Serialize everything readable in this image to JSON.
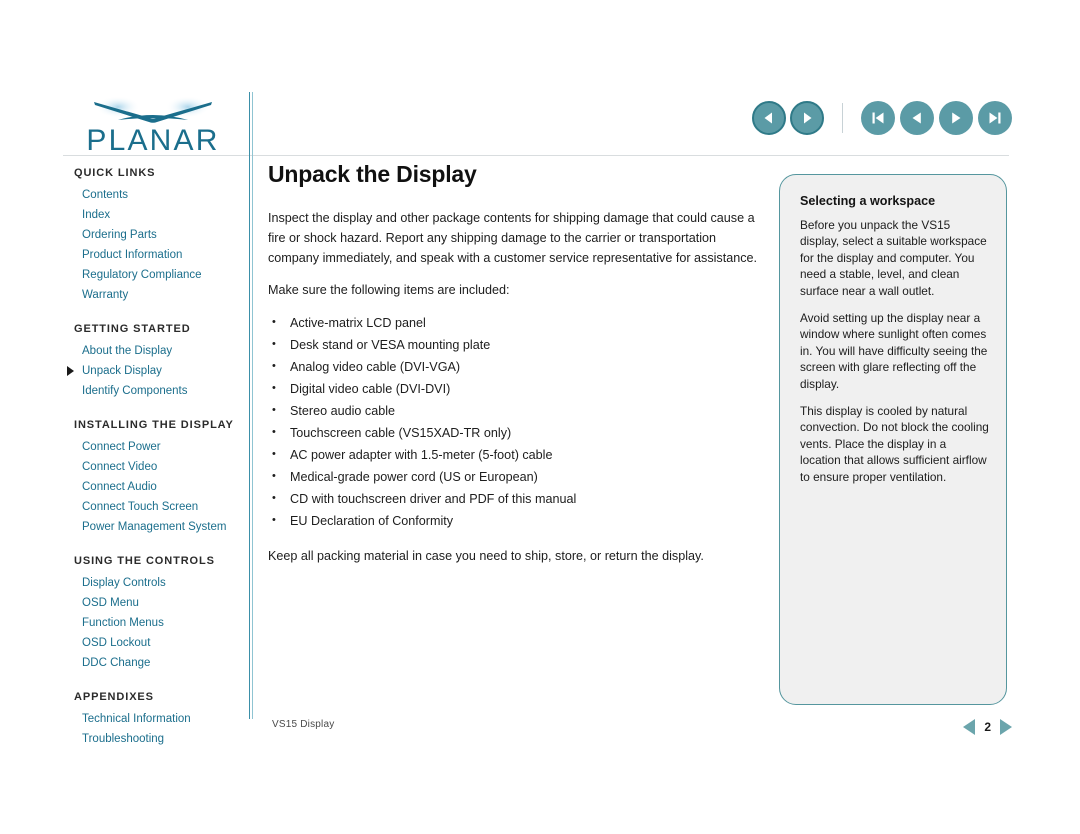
{
  "brand": {
    "name": "PLANAR",
    "logo_color": "#1b6e8c",
    "swoosh_glow": "#bcdcee"
  },
  "topnav": {
    "group1": [
      {
        "icon": "arrow-left-icon",
        "name": "back-button"
      },
      {
        "icon": "arrow-right-icon",
        "name": "forward-button"
      }
    ],
    "group2": [
      {
        "icon": "first-page-icon",
        "name": "first-page-button"
      },
      {
        "icon": "previous-page-icon",
        "name": "previous-page-button"
      },
      {
        "icon": "next-page-icon",
        "name": "next-page-button"
      },
      {
        "icon": "last-page-icon",
        "name": "last-page-button"
      }
    ],
    "button_color": "#5b9ba6",
    "ring_color": "#2f7a88"
  },
  "sidebar": {
    "sections": [
      {
        "heading": "QUICK LINKS",
        "links": [
          {
            "label": "Contents",
            "current": false
          },
          {
            "label": "Index",
            "current": false
          },
          {
            "label": "Ordering Parts",
            "current": false
          },
          {
            "label": "Product Information",
            "current": false
          },
          {
            "label": "Regulatory Compliance",
            "current": false
          },
          {
            "label": "Warranty",
            "current": false
          }
        ]
      },
      {
        "heading": "GETTING STARTED",
        "links": [
          {
            "label": "About the Display",
            "current": false
          },
          {
            "label": "Unpack Display",
            "current": true
          },
          {
            "label": "Identify Components",
            "current": false
          }
        ]
      },
      {
        "heading": "INSTALLING THE DISPLAY",
        "links": [
          {
            "label": "Connect Power",
            "current": false
          },
          {
            "label": "Connect Video",
            "current": false
          },
          {
            "label": "Connect Audio",
            "current": false
          },
          {
            "label": "Connect Touch Screen",
            "current": false
          },
          {
            "label": "Power Management System",
            "current": false
          }
        ]
      },
      {
        "heading": "USING THE CONTROLS",
        "links": [
          {
            "label": "Display Controls",
            "current": false
          },
          {
            "label": "OSD Menu",
            "current": false
          },
          {
            "label": "Function Menus",
            "current": false
          },
          {
            "label": "OSD Lockout",
            "current": false
          },
          {
            "label": "DDC Change",
            "current": false
          }
        ]
      },
      {
        "heading": "APPENDIXES",
        "links": [
          {
            "label": "Technical Information",
            "current": false
          },
          {
            "label": "Troubleshooting",
            "current": false
          }
        ]
      }
    ],
    "link_color": "#1b6e8c",
    "heading_color": "#2b2b2b"
  },
  "main": {
    "title": "Unpack the Display",
    "intro": "Inspect the display and other package contents for shipping damage that could cause a fire or shock hazard. Report any shipping damage to the carrier or transportation company immediately, and speak with a customer service representative for assistance.",
    "list_lead": "Make sure the following items are included:",
    "items": [
      "Active-matrix LCD panel",
      "Desk stand or VESA mounting plate",
      "Analog video cable (DVI-VGA)",
      "Digital video cable (DVI-DVI)",
      "Stereo audio cable",
      "Touchscreen cable (VS15XAD-TR only)",
      "AC power adapter with 1.5-meter (5-foot) cable",
      "Medical-grade power cord (US or European)",
      "CD with touchscreen driver and PDF of this manual",
      "EU Declaration of Conformity"
    ],
    "closing": "Keep all packing material in case you need to ship, store, or return the display."
  },
  "callout": {
    "title": "Selecting a workspace",
    "paragraphs": [
      "Before you unpack the VS15 display, select a suitable workspace for the display and computer. You need a stable, level, and clean surface near a wall outlet.",
      "Avoid setting up the display near a window where sunlight often comes in. You will have difficulty seeing the screen with glare reflecting off the display.",
      "This display is cooled by natural convection. Do not block the cooling vents. Place the display in a location that allows sufficient airflow to ensure proper ventilation."
    ],
    "border_color": "#55969e",
    "fill_color": "#f0f0f0"
  },
  "footer": {
    "doc_label": "VS15 Display",
    "page_number": "2",
    "prev_icon": "triangle-left-icon",
    "next_icon": "triangle-right-icon",
    "arrow_color": "#6ba5ac"
  }
}
